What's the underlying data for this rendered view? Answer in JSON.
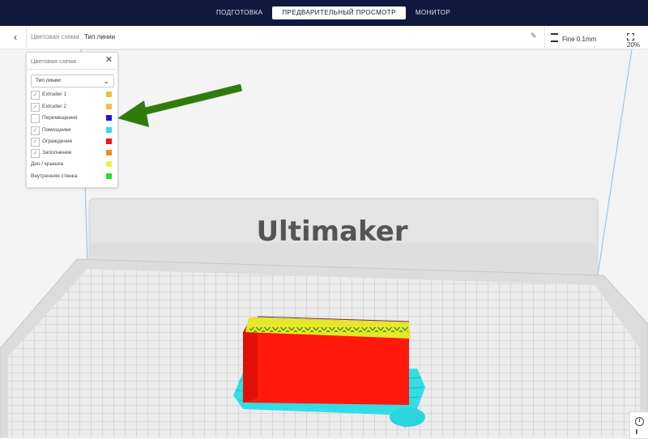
{
  "header": {
    "tabs": [
      {
        "label": "ПОДГОТОВКА",
        "active": false
      },
      {
        "label": "ПРЕДВАРИТЕЛЬНЫЙ ПРОСМОТР",
        "active": true
      },
      {
        "label": "МОНИТОР",
        "active": false
      }
    ]
  },
  "toolbar": {
    "breadcrumb_parent": "Цветовая схема",
    "breadcrumb_current": "Тип линии",
    "profile_label": "Fine 0.1mm",
    "infill_label": "20%"
  },
  "color_panel": {
    "title": "Цветовая схема",
    "dropdown_value": "Тип линии",
    "items": [
      {
        "label": "Extruder 1",
        "checkbox": true,
        "checked": true,
        "color": "#f2c13c"
      },
      {
        "label": "Extruder 2",
        "checkbox": true,
        "checked": true,
        "color": "#f2c13c"
      },
      {
        "label": "Перемещения",
        "checkbox": true,
        "checked": false,
        "color": "#1a1ad0"
      },
      {
        "label": "Помощники",
        "checkbox": true,
        "checked": true,
        "color": "#32dce8"
      },
      {
        "label": "Ограждение",
        "checkbox": true,
        "checked": true,
        "color": "#e81a12"
      },
      {
        "label": "Заполнение",
        "checkbox": true,
        "checked": true,
        "color": "#f28a22"
      },
      {
        "label": "Дно / крышка",
        "checkbox": false,
        "checked": false,
        "color": "#f2f23c"
      },
      {
        "label": "Внутренняя стенка",
        "checkbox": false,
        "checked": false,
        "color": "#22e02c"
      }
    ]
  },
  "scene": {
    "backplate_brand": "Ultimaker",
    "annotation_arrow_color": "#2e7d0c"
  },
  "colors": {
    "header_bg": "#10193d",
    "model_wall": "#ff1a0d",
    "model_top": "#e6e62a",
    "skirt": "#2ee0e8"
  }
}
